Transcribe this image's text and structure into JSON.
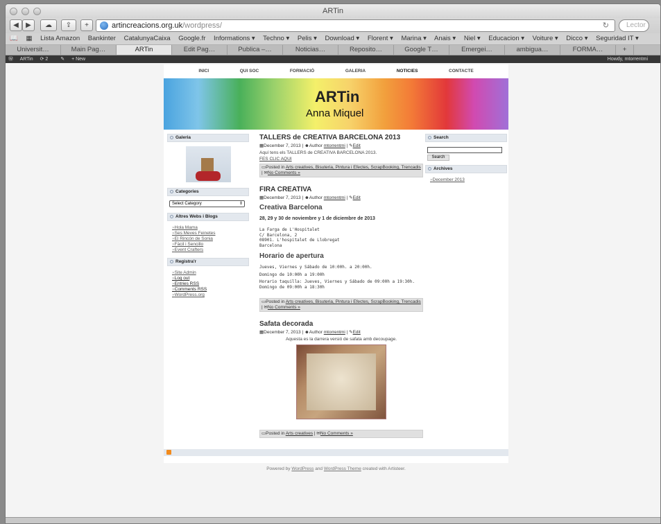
{
  "window": {
    "title": "ARTin"
  },
  "toolbar": {
    "url_domain": "artincreacions.org.uk",
    "url_path": "/wordpress/",
    "reload_glyph": "↻",
    "search_placeholder": "Lector"
  },
  "bookmarks": [
    "Lista Amazon",
    "Bankinter",
    "CatalunyaCaixa",
    "Google.fr",
    "Informations ▾",
    "Techno ▾",
    "Pelis ▾",
    "Download ▾",
    "Florent ▾",
    "Marina ▾",
    "Anais ▾",
    "Niel ▾",
    "Educacion ▾",
    "Voiture ▾",
    "Dicco ▾",
    "Seguridad IT ▾"
  ],
  "tabs": [
    "Universit…",
    "Main Pag…",
    "ARTin",
    "Edit Pag…",
    "Publica –…",
    "Noticias…",
    "Reposito…",
    "Google T…",
    "Emergei…",
    "ambigua…",
    "FORMA…"
  ],
  "active_tab": 2,
  "adminbar": {
    "site": "ARTin",
    "updates": "2",
    "new": "+ New",
    "howdy": "Howdy, mtorrentmi"
  },
  "nav": [
    "INICI",
    "QUI SOC",
    "FORMACIÓ",
    "GALERIA",
    "NOTICIES",
    "CONTACTE"
  ],
  "header": {
    "title": "ARTin",
    "subtitle": "Anna Miquel"
  },
  "sidebar_left": {
    "galeria": "Galeria",
    "categories": "Categories",
    "select_category": "Select Category",
    "altres_title": "Altres Webs i Blogs",
    "altres_links": [
      "Hola Mama",
      "Ses Meves Feinetes",
      "El Rincón de Sonia",
      "Fàcil i Sencillo",
      "Event Crafters"
    ],
    "registra_title": "Registra'r",
    "registra_links": [
      "Site Admin",
      "Log out",
      "Entries RSS",
      "Comments RSS",
      "WordPress.org"
    ]
  },
  "posts": {
    "p1": {
      "title": "TALLERS de CREATIVA BARCELONA 2013",
      "date": "December 7, 2013",
      "author_label": "Author",
      "author": "mtorrentmi",
      "edit": "Edit",
      "body": "Aquí tens els TALLERS de  CREATIVA BARCELONA 2013.",
      "link": "FES CLIC AQUI",
      "footer_posted": "Posted in",
      "categories": "Arts creatives, Bisuteria, Pintura i Efectes, ScrapBooking, Trencadis",
      "comments": "No Comments »"
    },
    "p2": {
      "title": "FIRA CREATIVA",
      "date": "December 7, 2013",
      "author": "mtorrentmi",
      "h_creativa": "Creativa Barcelona",
      "dates": "28, 29 y 30 de noviembre y 1 de diciembre de 2013",
      "addr1": "La Farga de L'Hospitalet",
      "addr2": "C/ Barcelona, 2",
      "addr3": "08901. L'hospitalet de Llobregat",
      "addr4": "Barcelona",
      "h_horario": "Horario de apertura",
      "hor1": "Jueves, Viernes y Sábado de 10:00h. a 20:00h.",
      "hor2": "Domingo  de 10:00h a 19:00h",
      "hor3": "Horario taquilla: Jueves, Viernes y Sábado de 09:00h a 19:30h. Domingo de 09:00h a 18:30h",
      "categories": "Arts creatives, Bisuteria, Pintura i Efectes, ScrapBooking, Trencadis",
      "comments": "No Comments »"
    },
    "p3": {
      "title": "Safata decorada",
      "date": "December 7, 2013",
      "author": "mtorrentmi",
      "body": "Aquesta es la darrera versió  de safata amb decoupage.",
      "categories": "Arts creatives",
      "comments": "No Comments »"
    }
  },
  "sidebar_right": {
    "search_title": "Search",
    "search_button": "Search",
    "archives_title": "Archives",
    "archive_link": "December 2013"
  },
  "footer": {
    "powered": "Powered by",
    "wp": "WordPress",
    "and": "and",
    "theme": "WordPress Theme",
    "created": "created with Artisteer."
  }
}
